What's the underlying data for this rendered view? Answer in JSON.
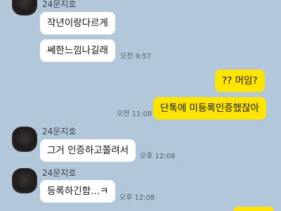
{
  "messages": [
    {
      "sender": "24문지호",
      "text": "작년이랑다르게"
    },
    {
      "text": "쎄한느낌나길래",
      "time": "오전 9:57"
    },
    {
      "text": "?? 머임?"
    },
    {
      "text": "단톡에 미등록인증했잖아",
      "time": "오전 11:08"
    },
    {
      "sender": "24문지호",
      "text": "그거 인증하고쫄려서",
      "time": "오후 12:08"
    },
    {
      "sender": "24문지호",
      "text": "등록하긴함...ㅋ",
      "time": "오후 12:08"
    }
  ],
  "colors": {
    "background": "#b2c7d9",
    "incoming_bubble": "#ffffff",
    "outgoing_bubble": "#fee500"
  }
}
